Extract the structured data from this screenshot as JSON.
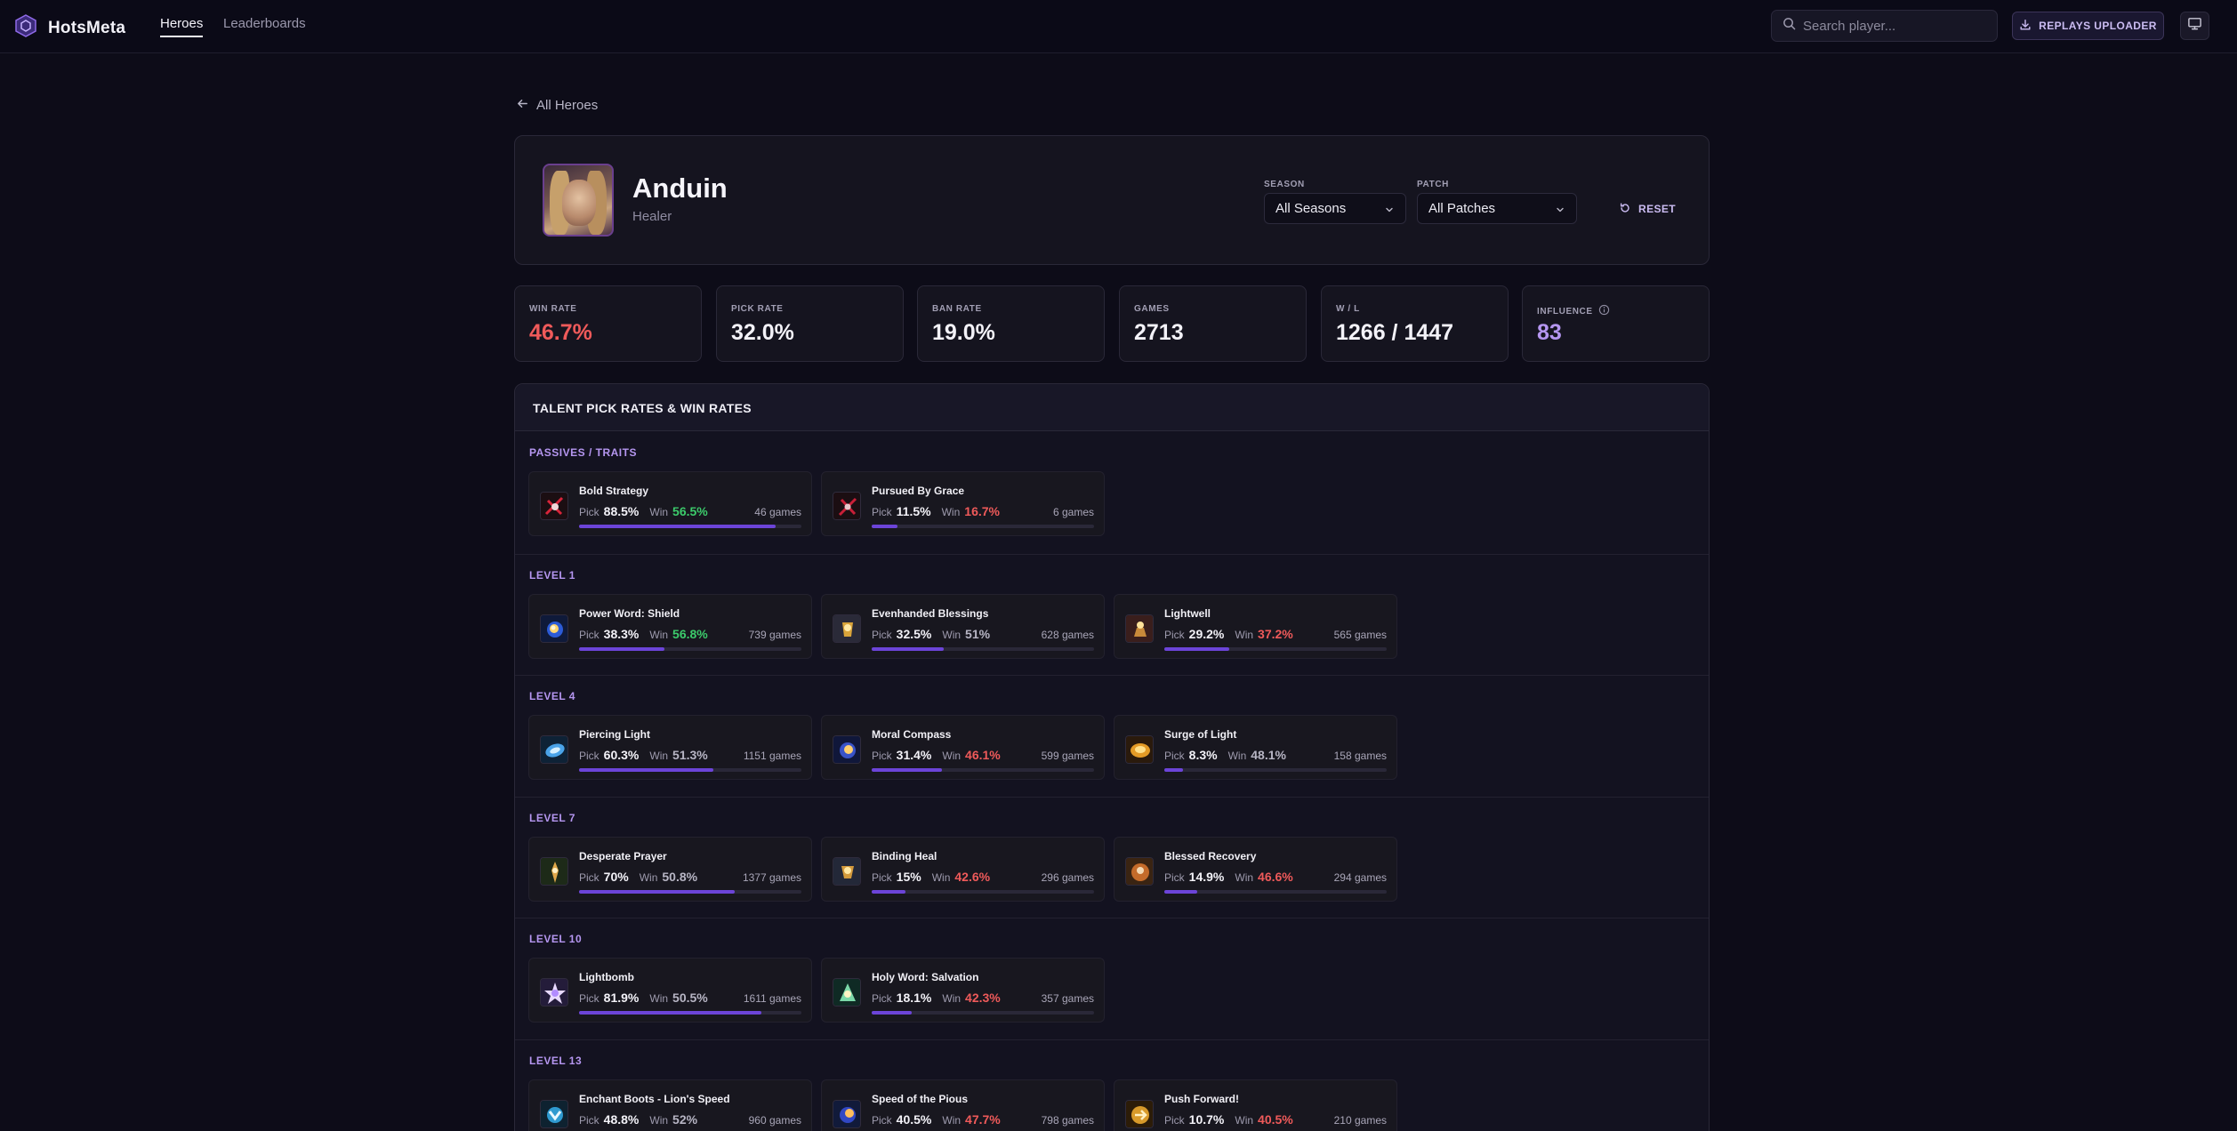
{
  "app": {
    "name": "HotsMeta"
  },
  "nav": {
    "tabs": [
      {
        "label": "Heroes",
        "active": true
      },
      {
        "label": "Leaderboards",
        "active": false
      }
    ]
  },
  "search": {
    "placeholder": "Search player..."
  },
  "replays_button": {
    "label": "REPLAYS UPLOADER"
  },
  "back_link": {
    "label": "All Heroes"
  },
  "hero": {
    "name": "Anduin",
    "role": "Healer"
  },
  "filters": {
    "season": {
      "label": "SEASON",
      "value": "All Seasons"
    },
    "patch": {
      "label": "PATCH",
      "value": "All Patches"
    },
    "reset_label": "RESET"
  },
  "stats": [
    {
      "label": "WIN RATE",
      "value": "46.7%",
      "color": "#ef5a5a"
    },
    {
      "label": "PICK RATE",
      "value": "32.0%"
    },
    {
      "label": "BAN RATE",
      "value": "19.0%"
    },
    {
      "label": "GAMES",
      "value": "2713"
    },
    {
      "label": "W / L",
      "value": "1266 / 1447"
    },
    {
      "label": "INFLUENCE",
      "value": "83",
      "color": "#b596f0"
    }
  ],
  "talents_panel": {
    "title": "TALENT PICK RATES & WIN RATES",
    "pick_label": "Pick",
    "win_label": "Win",
    "tiers": [
      {
        "label": "PASSIVES / TRAITS",
        "talents": [
          {
            "name": "Bold Strategy",
            "pick": "88.5%",
            "win": "56.5%",
            "win_color": "green",
            "games": "46 games",
            "icon": "bold-strategy-icon",
            "pick_fraction": 0.885
          },
          {
            "name": "Pursued By Grace",
            "pick": "11.5%",
            "win": "16.7%",
            "win_color": "red",
            "games": "6 games",
            "icon": "pursued-by-grace-icon",
            "pick_fraction": 0.115
          }
        ]
      },
      {
        "label": "LEVEL 1",
        "talents": [
          {
            "name": "Power Word: Shield",
            "pick": "38.3%",
            "win": "56.8%",
            "win_color": "green",
            "games": "739 games",
            "icon": "power-word-shield-icon",
            "pick_fraction": 0.383
          },
          {
            "name": "Evenhanded Blessings",
            "pick": "32.5%",
            "win": "51%",
            "win_color": "plain",
            "games": "628 games",
            "icon": "evenhanded-blessings-icon",
            "pick_fraction": 0.325
          },
          {
            "name": "Lightwell",
            "pick": "29.2%",
            "win": "37.2%",
            "win_color": "red",
            "games": "565 games",
            "icon": "lightwell-icon",
            "pick_fraction": 0.292
          }
        ]
      },
      {
        "label": "LEVEL 4",
        "talents": [
          {
            "name": "Piercing Light",
            "pick": "60.3%",
            "win": "51.3%",
            "win_color": "plain",
            "games": "1151 games",
            "icon": "piercing-light-icon",
            "pick_fraction": 0.603
          },
          {
            "name": "Moral Compass",
            "pick": "31.4%",
            "win": "46.1%",
            "win_color": "red",
            "games": "599 games",
            "icon": "moral-compass-icon",
            "pick_fraction": 0.314
          },
          {
            "name": "Surge of Light",
            "pick": "8.3%",
            "win": "48.1%",
            "win_color": "plain",
            "games": "158 games",
            "icon": "surge-of-light-icon",
            "pick_fraction": 0.083
          }
        ]
      },
      {
        "label": "LEVEL 7",
        "talents": [
          {
            "name": "Desperate Prayer",
            "pick": "70%",
            "win": "50.8%",
            "win_color": "plain",
            "games": "1377 games",
            "icon": "desperate-prayer-icon",
            "pick_fraction": 0.7
          },
          {
            "name": "Binding Heal",
            "pick": "15%",
            "win": "42.6%",
            "win_color": "red",
            "games": "296 games",
            "icon": "binding-heal-icon",
            "pick_fraction": 0.15
          },
          {
            "name": "Blessed Recovery",
            "pick": "14.9%",
            "win": "46.6%",
            "win_color": "red",
            "games": "294 games",
            "icon": "blessed-recovery-icon",
            "pick_fraction": 0.149
          }
        ]
      },
      {
        "label": "LEVEL 10",
        "talents": [
          {
            "name": "Lightbomb",
            "pick": "81.9%",
            "win": "50.5%",
            "win_color": "plain",
            "games": "1611 games",
            "icon": "lightbomb-icon",
            "pick_fraction": 0.819
          },
          {
            "name": "Holy Word: Salvation",
            "pick": "18.1%",
            "win": "42.3%",
            "win_color": "red",
            "games": "357 games",
            "icon": "holy-word-salvation-icon",
            "pick_fraction": 0.181
          }
        ]
      },
      {
        "label": "LEVEL 13",
        "talents": [
          {
            "name": "Enchant Boots - Lion's Speed",
            "pick": "48.8%",
            "win": "52%",
            "win_color": "plain",
            "games": "960 games",
            "icon": "enchant-boots-icon",
            "pick_fraction": 0.488
          },
          {
            "name": "Speed of the Pious",
            "pick": "40.5%",
            "win": "47.7%",
            "win_color": "red",
            "games": "798 games",
            "icon": "speed-of-the-pious-icon",
            "pick_fraction": 0.405
          },
          {
            "name": "Push Forward!",
            "pick": "10.7%",
            "win": "40.5%",
            "win_color": "red",
            "games": "210 games",
            "icon": "push-forward-icon",
            "pick_fraction": 0.107
          }
        ]
      }
    ]
  }
}
